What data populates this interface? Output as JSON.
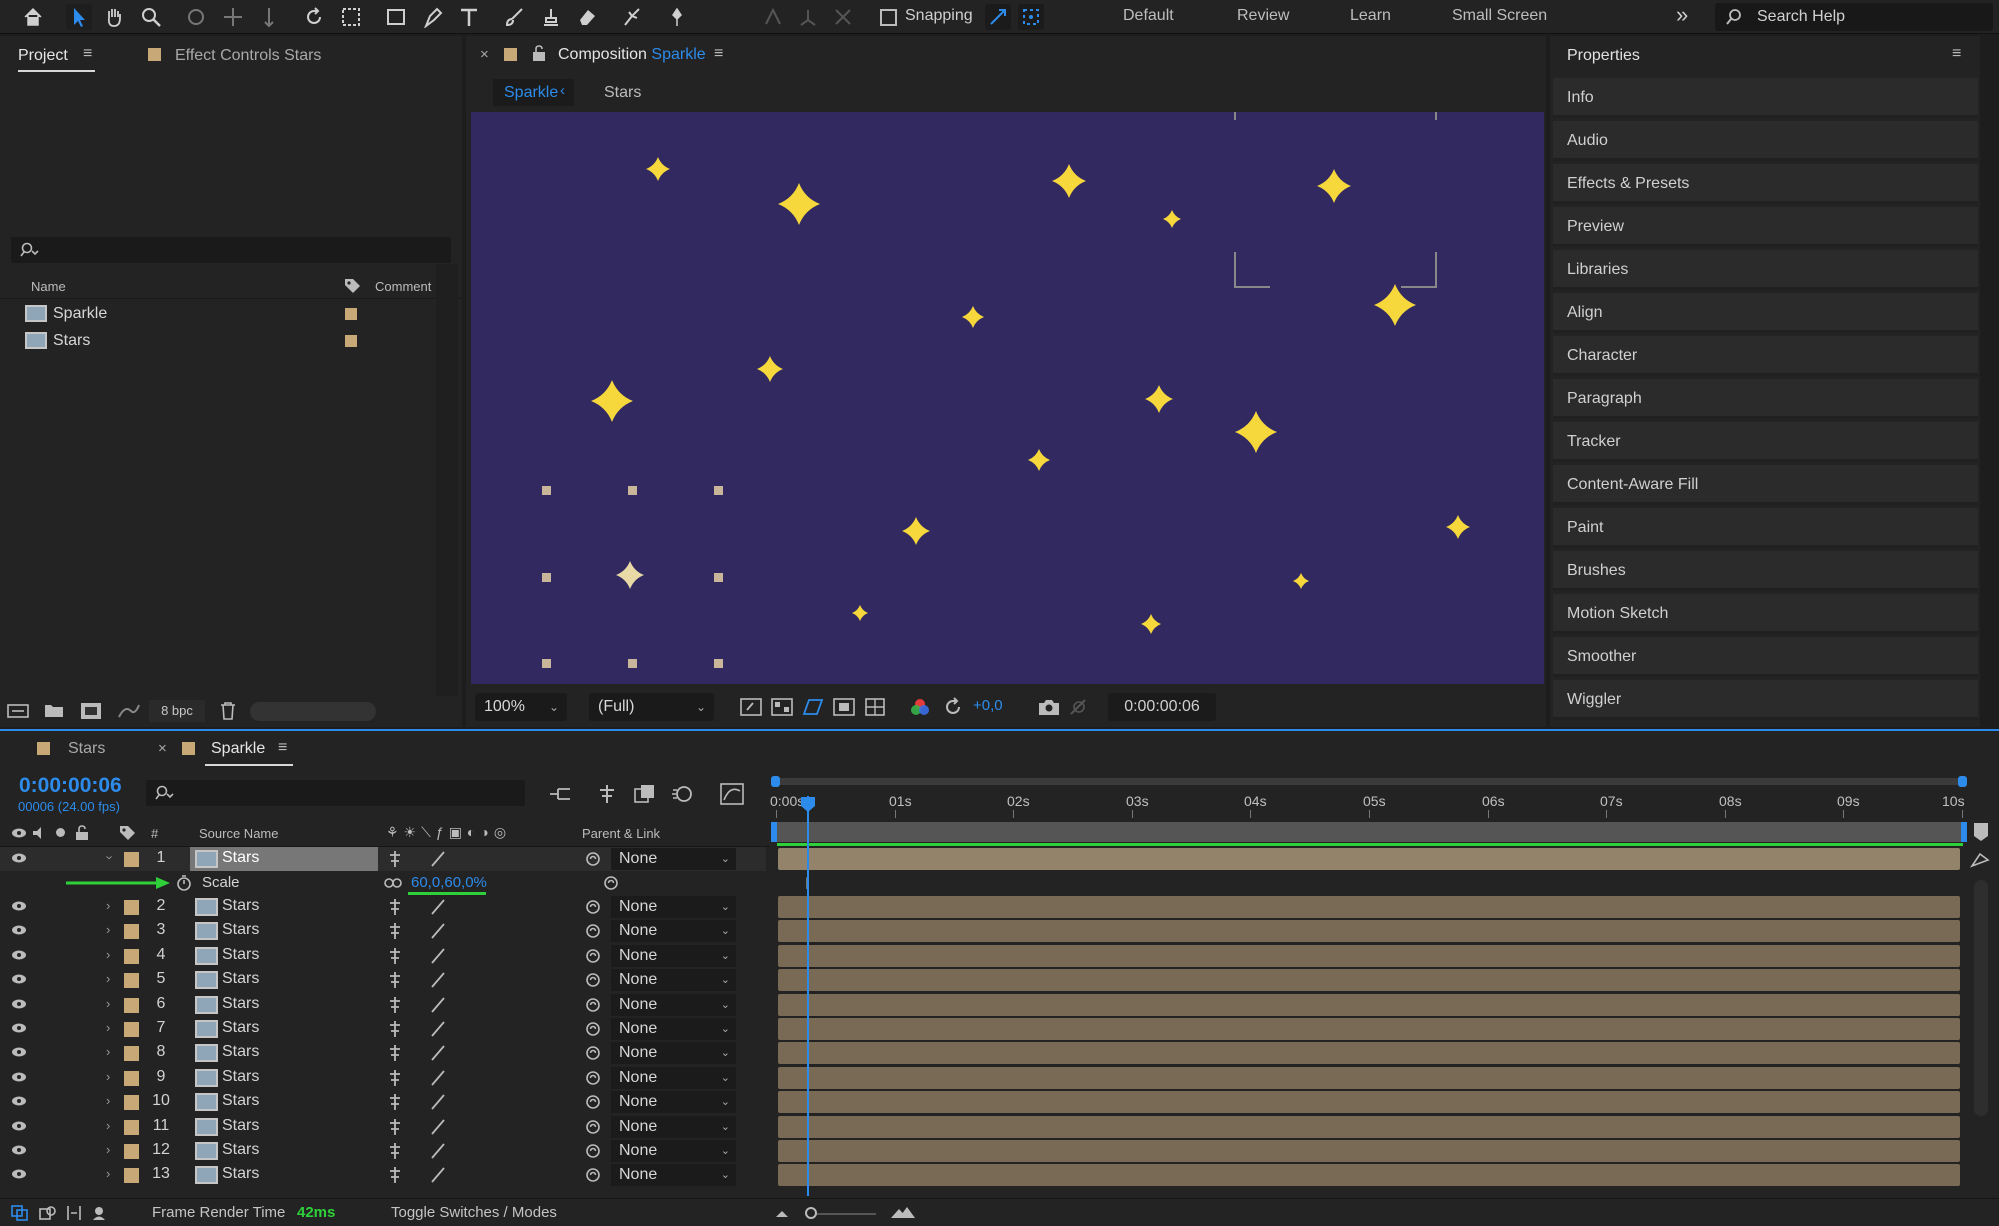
{
  "toolbar": {
    "snapping_label": "Snapping",
    "workspaces": [
      "Default",
      "Review",
      "Learn",
      "Small Screen"
    ],
    "search_placeholder": "Search Help"
  },
  "project_panel": {
    "tab_project": "Project",
    "tab_effect_controls": "Effect Controls Stars",
    "col_name": "Name",
    "col_comment": "Comment",
    "items": [
      {
        "name": "Sparkle"
      },
      {
        "name": "Stars"
      }
    ],
    "bpc": "8 bpc"
  },
  "composition": {
    "tab_prefix": "Composition",
    "tab_name": "Sparkle",
    "breadcrumb": [
      "Sparkle",
      "Stars"
    ],
    "zoom": "100%",
    "resolution": "(Full)",
    "exposure": "+0,0",
    "timecode": "0:00:00:06",
    "bg_color": "#312960",
    "star_color": "#f6d73c"
  },
  "properties_panel": {
    "title": "Properties",
    "items": [
      "Info",
      "Audio",
      "Effects & Presets",
      "Preview",
      "Libraries",
      "Align",
      "Character",
      "Paragraph",
      "Tracker",
      "Content-Aware Fill",
      "Paint",
      "Brushes",
      "Motion Sketch",
      "Smoother",
      "Wiggler"
    ]
  },
  "timeline": {
    "tab_stars": "Stars",
    "tab_sparkle": "Sparkle",
    "current_time": "0:00:00:06",
    "frame_info": "00006 (24.00 fps)",
    "col_hash": "#",
    "col_source": "Source Name",
    "col_parent": "Parent & Link",
    "ruler": [
      "0:00s",
      "01s",
      "02s",
      "03s",
      "04s",
      "05s",
      "06s",
      "07s",
      "08s",
      "09s",
      "10s"
    ],
    "scale_label": "Scale",
    "scale_value": "60,0,60,0%",
    "layers": [
      {
        "num": "1",
        "name": "Stars",
        "parent": "None"
      },
      {
        "num": "2",
        "name": "Stars",
        "parent": "None"
      },
      {
        "num": "3",
        "name": "Stars",
        "parent": "None"
      },
      {
        "num": "4",
        "name": "Stars",
        "parent": "None"
      },
      {
        "num": "5",
        "name": "Stars",
        "parent": "None"
      },
      {
        "num": "6",
        "name": "Stars",
        "parent": "None"
      },
      {
        "num": "7",
        "name": "Stars",
        "parent": "None"
      },
      {
        "num": "8",
        "name": "Stars",
        "parent": "None"
      },
      {
        "num": "9",
        "name": "Stars",
        "parent": "None"
      },
      {
        "num": "10",
        "name": "Stars",
        "parent": "None"
      },
      {
        "num": "11",
        "name": "Stars",
        "parent": "None"
      },
      {
        "num": "12",
        "name": "Stars",
        "parent": "None"
      },
      {
        "num": "13",
        "name": "Stars",
        "parent": "None"
      }
    ],
    "frame_render_label": "Frame Render Time",
    "frame_render_value": "42ms",
    "toggle_label": "Toggle Switches / Modes",
    "accent_color": "#2d8ceb",
    "bar_color": "#786a55",
    "workarea_color": "#2fd13a"
  }
}
